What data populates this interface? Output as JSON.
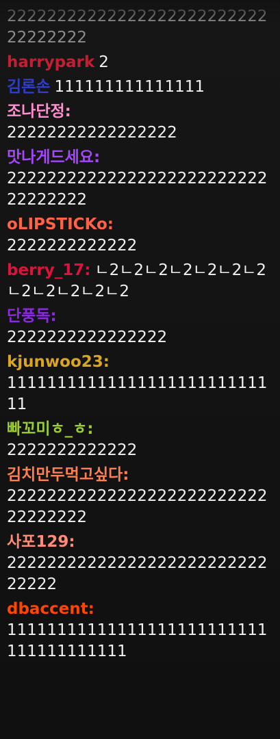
{
  "messages": [
    {
      "user": "",
      "text": "2222222222222222222222222222222222",
      "dim": true
    },
    {
      "user": "harrypark",
      "text": "2",
      "color": "#c21e34"
    },
    {
      "user": "김론손",
      "text": "111111111111111",
      "color": "#2f3dc8"
    },
    {
      "user": "조나단정:",
      "text": "22222222222222222",
      "color": "#ff8fd1"
    },
    {
      "user": "맛나게드세요:",
      "text": "2222222222222222222222222222222222",
      "color": "#a646ff"
    },
    {
      "user": "oLIPSTICKo:",
      "text": "2222222222222",
      "color": "#ff6347"
    },
    {
      "user": "berry_17:",
      "text": "ㄴ2ㄴ2ㄴ2ㄴ2ㄴ2ㄴ2ㄴ2ㄴ2ㄴ2ㄴ2ㄴ2ㄴ2",
      "color": "#dc143c"
    },
    {
      "user": "단풍독:",
      "text": "2222222222222222",
      "color": "#8a2be2"
    },
    {
      "user": "kjunwoo23:",
      "text": "1111111111111111111111111111",
      "color": "#daa520"
    },
    {
      "user": "빠꼬미ㅎ_ㅎ:",
      "text": "2222222222222",
      "color": "#9acd32"
    },
    {
      "user": "김치만두먹고싶다:",
      "text": "2222222222222222222222222222222222",
      "color": "#ff7f50"
    },
    {
      "user": "사포129:",
      "text": "2222222222222222222222222222222",
      "color": "#ff8c78"
    },
    {
      "user": "dbaccent:",
      "text": "11111111111111111111111111111111111111",
      "color": "#ff4500"
    }
  ]
}
